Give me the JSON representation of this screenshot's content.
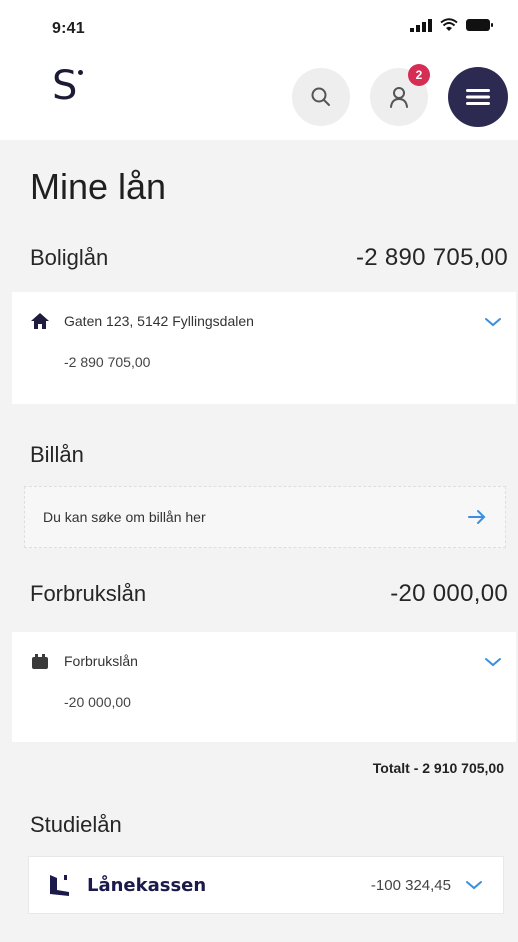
{
  "status_bar": {
    "time": "9:41"
  },
  "header": {
    "logo": "S",
    "notifications_badge": "2",
    "icons": {
      "search": "search-icon",
      "profile": "user-icon",
      "menu": "hamburger-menu-icon"
    },
    "menu_color": "#2d2a51",
    "badge_color": "#d62d54"
  },
  "page": {
    "title": "Mine lån"
  },
  "boliglan": {
    "title": "Boliglån",
    "amount": "-2 890 705,00",
    "items": [
      {
        "name": "Gaten 123, 5142 Fyllingsdalen",
        "amount": "-2 890 705,00",
        "icon": "house-icon"
      }
    ]
  },
  "billan": {
    "title": "Billån",
    "cta": "Du kan søke om billån her"
  },
  "forbrukslan": {
    "title": "Forbrukslån",
    "amount": "-20 000,00",
    "items": [
      {
        "name": "Forbrukslån",
        "amount": "-20 000,00",
        "icon": "wallet-icon"
      }
    ]
  },
  "totals": {
    "text": "Totalt - 2 910 705,00"
  },
  "studielan": {
    "title": "Studielån",
    "provider": "Lånekassen",
    "amount": "-100 324,45"
  },
  "colors": {
    "accent": "#3b8fe0",
    "background": "#f3f3f4"
  }
}
